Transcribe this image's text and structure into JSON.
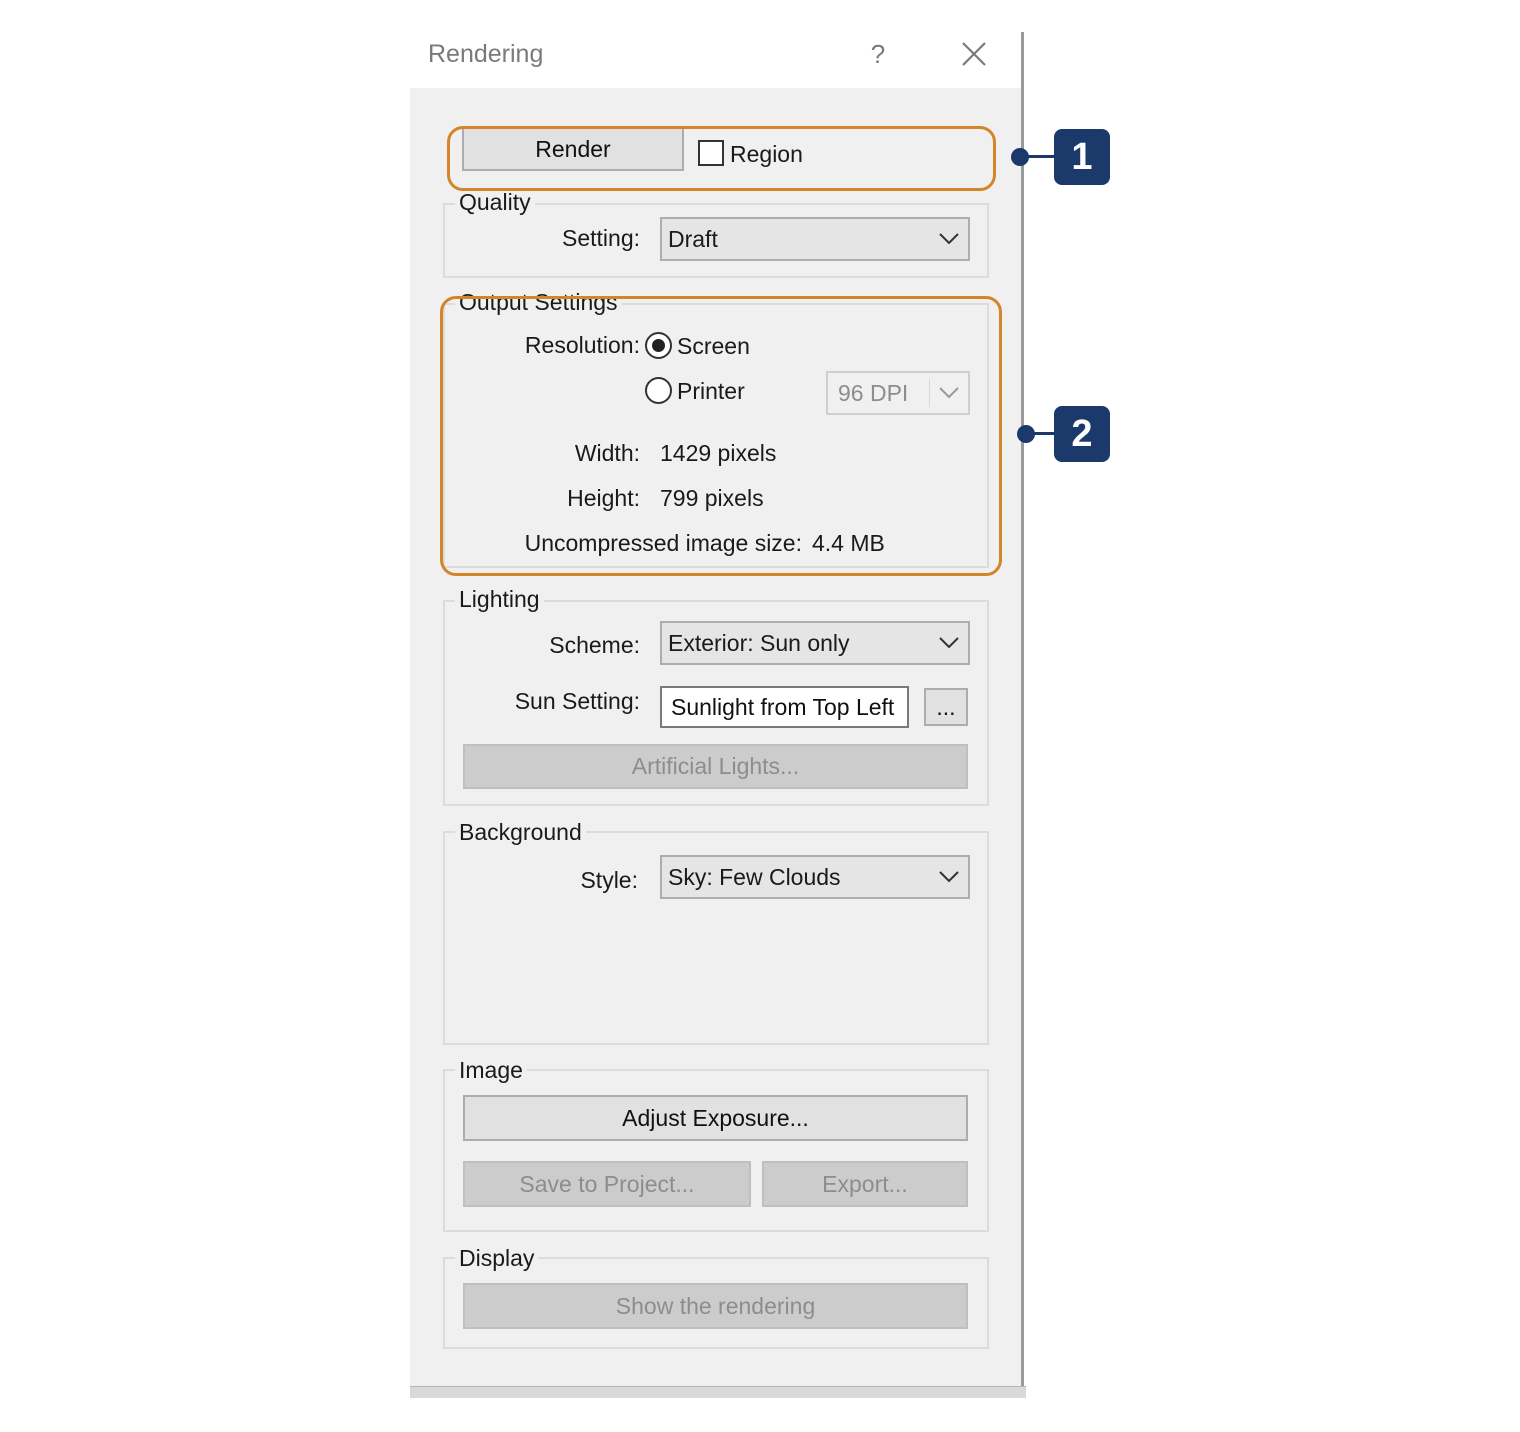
{
  "window": {
    "title": "Rendering",
    "help": "?",
    "icons": {
      "close": "close-icon"
    }
  },
  "render": {
    "render_label": "Render",
    "region_label": "Region",
    "region_checked": false
  },
  "quality": {
    "group_label": "Quality",
    "setting_label": "Setting:",
    "setting_value": "Draft"
  },
  "output": {
    "group_label": "Output Settings",
    "resolution_label": "Resolution:",
    "screen_label": "Screen",
    "printer_label": "Printer",
    "selected": "Screen",
    "dpi_value": "96 DPI",
    "width_label": "Width:",
    "width_value": "1429 pixels",
    "height_label": "Height:",
    "height_value": "799 pixels",
    "size_label": "Uncompressed image size:",
    "size_value": "4.4 MB"
  },
  "lighting": {
    "group_label": "Lighting",
    "scheme_label": "Scheme:",
    "scheme_value": "Exterior: Sun only",
    "sun_label": "Sun Setting:",
    "sun_value": "Sunlight from Top Left",
    "sun_button": "...",
    "artificial_label": "Artificial Lights..."
  },
  "background": {
    "group_label": "Background",
    "style_label": "Style:",
    "style_value": "Sky: Few Clouds"
  },
  "image": {
    "group_label": "Image",
    "adjust_label": "Adjust Exposure...",
    "save_label": "Save to Project...",
    "export_label": "Export..."
  },
  "display": {
    "group_label": "Display",
    "show_label": "Show the rendering"
  },
  "callouts": [
    "1",
    "2"
  ],
  "colors": {
    "callout_outline": "#d4852a",
    "callout_badge": "#1b3a6b"
  }
}
